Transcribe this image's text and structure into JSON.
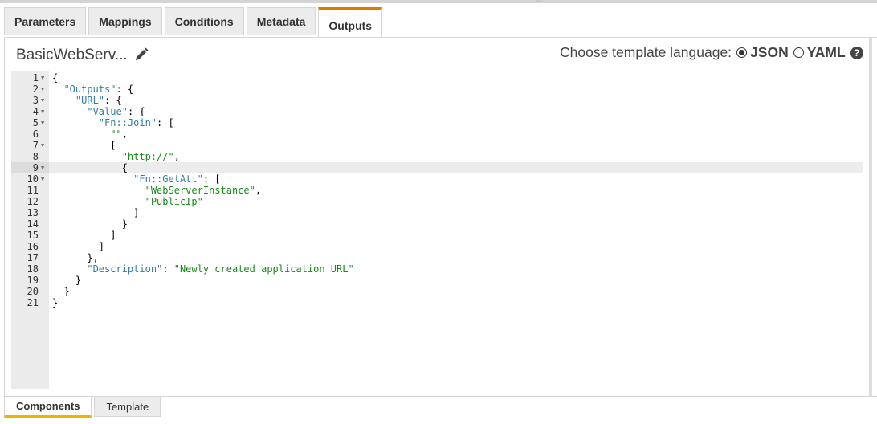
{
  "tabs": [
    {
      "label": "Parameters"
    },
    {
      "label": "Mappings"
    },
    {
      "label": "Conditions"
    },
    {
      "label": "Metadata"
    },
    {
      "label": "Outputs",
      "active": true
    }
  ],
  "header": {
    "title": "BasicWebServ...",
    "edit_icon": "pencil-icon",
    "language_label": "Choose template language:",
    "options": [
      {
        "label": "JSON",
        "selected": true
      },
      {
        "label": "YAML",
        "selected": false
      }
    ],
    "help_icon": "question-circle-icon"
  },
  "colors": {
    "active_tab": "#e07b00",
    "bottom_active_tab": "#f0b400",
    "key": "#2f7fa3",
    "string": "#1a8a1a"
  },
  "editor": {
    "active_line": 9,
    "lines": [
      {
        "n": "1",
        "fold": true,
        "tokens": [
          [
            "{",
            "p"
          ]
        ]
      },
      {
        "n": "2",
        "fold": true,
        "tokens": [
          [
            "  ",
            "p"
          ],
          [
            "\"Outputs\"",
            "k"
          ],
          [
            ": {",
            "p"
          ]
        ]
      },
      {
        "n": "3",
        "fold": true,
        "tokens": [
          [
            "    ",
            "p"
          ],
          [
            "\"URL\"",
            "k"
          ],
          [
            ": {",
            "p"
          ]
        ]
      },
      {
        "n": "4",
        "fold": true,
        "tokens": [
          [
            "      ",
            "p"
          ],
          [
            "\"Value\"",
            "k"
          ],
          [
            ": {",
            "p"
          ]
        ]
      },
      {
        "n": "5",
        "fold": true,
        "tokens": [
          [
            "        ",
            "p"
          ],
          [
            "\"Fn::Join\"",
            "k"
          ],
          [
            ": [",
            "p"
          ]
        ]
      },
      {
        "n": "6",
        "fold": false,
        "tokens": [
          [
            "          ",
            "p"
          ],
          [
            "\"\"",
            "s"
          ],
          [
            ",",
            "p"
          ]
        ]
      },
      {
        "n": "7",
        "fold": true,
        "tokens": [
          [
            "          [",
            "p"
          ]
        ]
      },
      {
        "n": "8",
        "fold": false,
        "tokens": [
          [
            "            ",
            "p"
          ],
          [
            "\"http://\"",
            "s"
          ],
          [
            ",",
            "p"
          ]
        ]
      },
      {
        "n": "9",
        "fold": true,
        "tokens": [
          [
            "            {",
            "p"
          ]
        ]
      },
      {
        "n": "10",
        "fold": true,
        "tokens": [
          [
            "              ",
            "p"
          ],
          [
            "\"Fn::GetAtt\"",
            "k"
          ],
          [
            ": [",
            "p"
          ]
        ]
      },
      {
        "n": "11",
        "fold": false,
        "tokens": [
          [
            "                ",
            "p"
          ],
          [
            "\"WebServerInstance\"",
            "s"
          ],
          [
            ",",
            "p"
          ]
        ]
      },
      {
        "n": "12",
        "fold": false,
        "tokens": [
          [
            "                ",
            "p"
          ],
          [
            "\"PublicIp\"",
            "s"
          ]
        ]
      },
      {
        "n": "13",
        "fold": false,
        "tokens": [
          [
            "              ]",
            "p"
          ]
        ]
      },
      {
        "n": "14",
        "fold": false,
        "tokens": [
          [
            "            }",
            "p"
          ]
        ]
      },
      {
        "n": "15",
        "fold": false,
        "tokens": [
          [
            "          ]",
            "p"
          ]
        ]
      },
      {
        "n": "16",
        "fold": false,
        "tokens": [
          [
            "        ]",
            "p"
          ]
        ]
      },
      {
        "n": "17",
        "fold": false,
        "tokens": [
          [
            "      },",
            "p"
          ]
        ]
      },
      {
        "n": "18",
        "fold": false,
        "tokens": [
          [
            "      ",
            "p"
          ],
          [
            "\"Description\"",
            "k"
          ],
          [
            ": ",
            "p"
          ],
          [
            "\"Newly created application URL\"",
            "s"
          ]
        ]
      },
      {
        "n": "19",
        "fold": false,
        "tokens": [
          [
            "    }",
            "p"
          ]
        ]
      },
      {
        "n": "20",
        "fold": false,
        "tokens": [
          [
            "  }",
            "p"
          ]
        ]
      },
      {
        "n": "21",
        "fold": false,
        "tokens": [
          [
            "}",
            "p"
          ]
        ]
      }
    ]
  },
  "bottom_tabs": [
    {
      "label": "Components",
      "active": true
    },
    {
      "label": "Template"
    }
  ]
}
